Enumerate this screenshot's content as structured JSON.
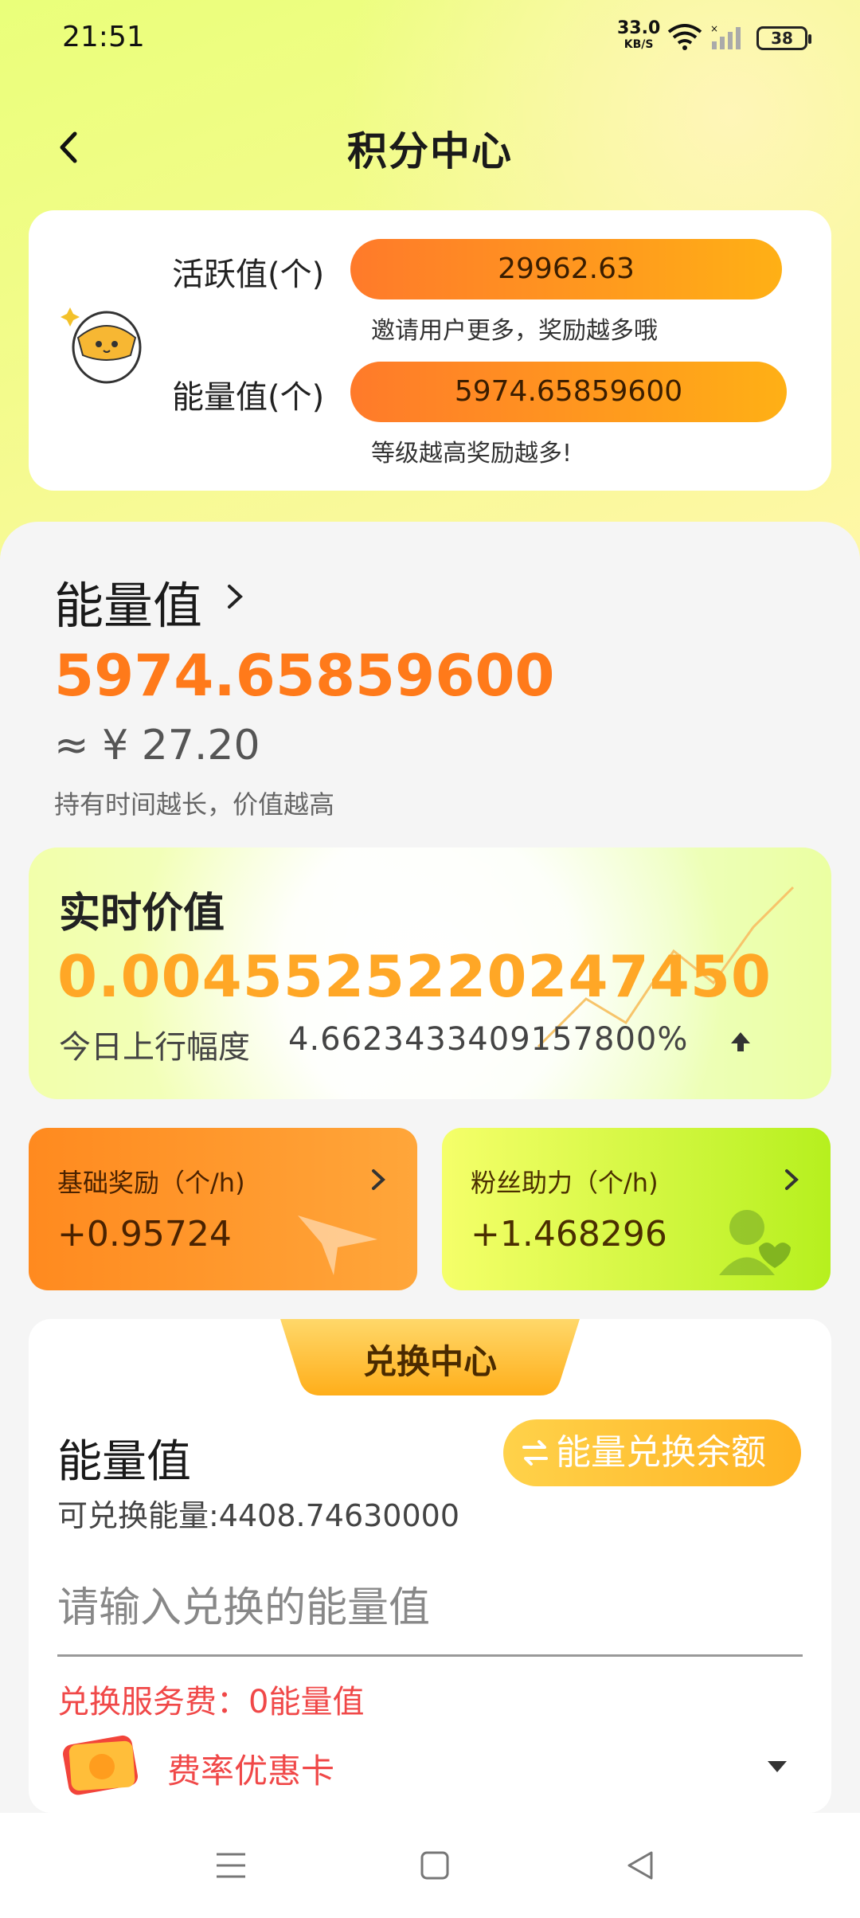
{
  "status_bar": {
    "time": "21:51",
    "speed": "33.0",
    "speed_unit": "KB/S",
    "battery": "38"
  },
  "header": {
    "title": "积分中心"
  },
  "summary": {
    "active_label": "活跃值(个)",
    "active_value": "29962.63",
    "active_hint": "邀请用户更多，奖励越多哦",
    "energy_label": "能量值(个)",
    "energy_value": "5974.65859600",
    "energy_hint": "等级越高奖励越多!"
  },
  "energy": {
    "title": "能量值",
    "value": "5974.65859600",
    "cny": "≈ ¥ 27.20",
    "note": "持有时间越长，价值越高"
  },
  "realtime": {
    "title": "实时价值",
    "value": "0.0045525220247450",
    "change_label": "今日上行幅度",
    "change_value": "4.6623433409157800%"
  },
  "rewards": {
    "base_label": "基础奖励（个/h)",
    "base_value": "+0.95724",
    "fans_label": "粉丝助力（个/h)",
    "fans_value": "+1.468296"
  },
  "exchange": {
    "tab": "兑换中心",
    "heading": "能量值",
    "button": "能量兑换余额",
    "available": "可兑换能量:4408.74630000",
    "placeholder": "请输入兑换的能量值",
    "fee": "兑换服务费：0能量值",
    "card": "费率优惠卡"
  },
  "colors": {
    "accent": "#ff7a1a",
    "fee_red": "#f04848",
    "hero_bg": "#eaff7a"
  }
}
